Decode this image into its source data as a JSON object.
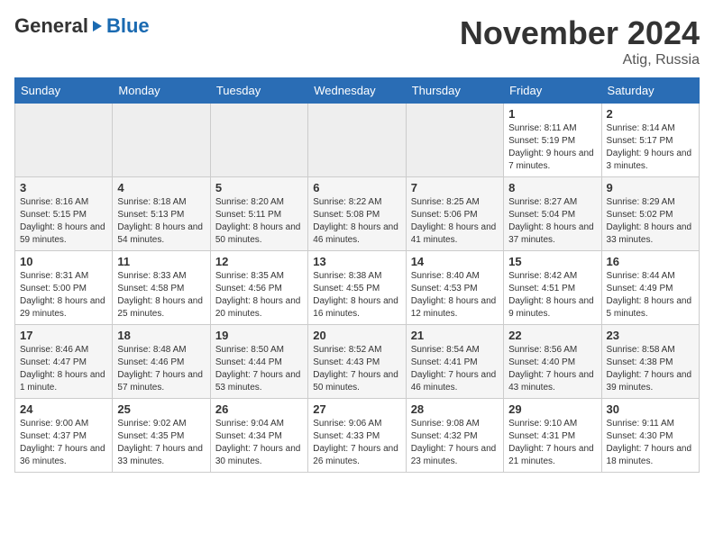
{
  "header": {
    "logo_general": "General",
    "logo_blue": "Blue",
    "month_title": "November 2024",
    "location": "Atig, Russia"
  },
  "days_of_week": [
    "Sunday",
    "Monday",
    "Tuesday",
    "Wednesday",
    "Thursday",
    "Friday",
    "Saturday"
  ],
  "weeks": [
    [
      {
        "day": "",
        "empty": true
      },
      {
        "day": "",
        "empty": true
      },
      {
        "day": "",
        "empty": true
      },
      {
        "day": "",
        "empty": true
      },
      {
        "day": "",
        "empty": true
      },
      {
        "day": "1",
        "sunrise": "Sunrise: 8:11 AM",
        "sunset": "Sunset: 5:19 PM",
        "daylight": "Daylight: 9 hours and 7 minutes."
      },
      {
        "day": "2",
        "sunrise": "Sunrise: 8:14 AM",
        "sunset": "Sunset: 5:17 PM",
        "daylight": "Daylight: 9 hours and 3 minutes."
      }
    ],
    [
      {
        "day": "3",
        "sunrise": "Sunrise: 8:16 AM",
        "sunset": "Sunset: 5:15 PM",
        "daylight": "Daylight: 8 hours and 59 minutes."
      },
      {
        "day": "4",
        "sunrise": "Sunrise: 8:18 AM",
        "sunset": "Sunset: 5:13 PM",
        "daylight": "Daylight: 8 hours and 54 minutes."
      },
      {
        "day": "5",
        "sunrise": "Sunrise: 8:20 AM",
        "sunset": "Sunset: 5:11 PM",
        "daylight": "Daylight: 8 hours and 50 minutes."
      },
      {
        "day": "6",
        "sunrise": "Sunrise: 8:22 AM",
        "sunset": "Sunset: 5:08 PM",
        "daylight": "Daylight: 8 hours and 46 minutes."
      },
      {
        "day": "7",
        "sunrise": "Sunrise: 8:25 AM",
        "sunset": "Sunset: 5:06 PM",
        "daylight": "Daylight: 8 hours and 41 minutes."
      },
      {
        "day": "8",
        "sunrise": "Sunrise: 8:27 AM",
        "sunset": "Sunset: 5:04 PM",
        "daylight": "Daylight: 8 hours and 37 minutes."
      },
      {
        "day": "9",
        "sunrise": "Sunrise: 8:29 AM",
        "sunset": "Sunset: 5:02 PM",
        "daylight": "Daylight: 8 hours and 33 minutes."
      }
    ],
    [
      {
        "day": "10",
        "sunrise": "Sunrise: 8:31 AM",
        "sunset": "Sunset: 5:00 PM",
        "daylight": "Daylight: 8 hours and 29 minutes."
      },
      {
        "day": "11",
        "sunrise": "Sunrise: 8:33 AM",
        "sunset": "Sunset: 4:58 PM",
        "daylight": "Daylight: 8 hours and 25 minutes."
      },
      {
        "day": "12",
        "sunrise": "Sunrise: 8:35 AM",
        "sunset": "Sunset: 4:56 PM",
        "daylight": "Daylight: 8 hours and 20 minutes."
      },
      {
        "day": "13",
        "sunrise": "Sunrise: 8:38 AM",
        "sunset": "Sunset: 4:55 PM",
        "daylight": "Daylight: 8 hours and 16 minutes."
      },
      {
        "day": "14",
        "sunrise": "Sunrise: 8:40 AM",
        "sunset": "Sunset: 4:53 PM",
        "daylight": "Daylight: 8 hours and 12 minutes."
      },
      {
        "day": "15",
        "sunrise": "Sunrise: 8:42 AM",
        "sunset": "Sunset: 4:51 PM",
        "daylight": "Daylight: 8 hours and 9 minutes."
      },
      {
        "day": "16",
        "sunrise": "Sunrise: 8:44 AM",
        "sunset": "Sunset: 4:49 PM",
        "daylight": "Daylight: 8 hours and 5 minutes."
      }
    ],
    [
      {
        "day": "17",
        "sunrise": "Sunrise: 8:46 AM",
        "sunset": "Sunset: 4:47 PM",
        "daylight": "Daylight: 8 hours and 1 minute."
      },
      {
        "day": "18",
        "sunrise": "Sunrise: 8:48 AM",
        "sunset": "Sunset: 4:46 PM",
        "daylight": "Daylight: 7 hours and 57 minutes."
      },
      {
        "day": "19",
        "sunrise": "Sunrise: 8:50 AM",
        "sunset": "Sunset: 4:44 PM",
        "daylight": "Daylight: 7 hours and 53 minutes."
      },
      {
        "day": "20",
        "sunrise": "Sunrise: 8:52 AM",
        "sunset": "Sunset: 4:43 PM",
        "daylight": "Daylight: 7 hours and 50 minutes."
      },
      {
        "day": "21",
        "sunrise": "Sunrise: 8:54 AM",
        "sunset": "Sunset: 4:41 PM",
        "daylight": "Daylight: 7 hours and 46 minutes."
      },
      {
        "day": "22",
        "sunrise": "Sunrise: 8:56 AM",
        "sunset": "Sunset: 4:40 PM",
        "daylight": "Daylight: 7 hours and 43 minutes."
      },
      {
        "day": "23",
        "sunrise": "Sunrise: 8:58 AM",
        "sunset": "Sunset: 4:38 PM",
        "daylight": "Daylight: 7 hours and 39 minutes."
      }
    ],
    [
      {
        "day": "24",
        "sunrise": "Sunrise: 9:00 AM",
        "sunset": "Sunset: 4:37 PM",
        "daylight": "Daylight: 7 hours and 36 minutes."
      },
      {
        "day": "25",
        "sunrise": "Sunrise: 9:02 AM",
        "sunset": "Sunset: 4:35 PM",
        "daylight": "Daylight: 7 hours and 33 minutes."
      },
      {
        "day": "26",
        "sunrise": "Sunrise: 9:04 AM",
        "sunset": "Sunset: 4:34 PM",
        "daylight": "Daylight: 7 hours and 30 minutes."
      },
      {
        "day": "27",
        "sunrise": "Sunrise: 9:06 AM",
        "sunset": "Sunset: 4:33 PM",
        "daylight": "Daylight: 7 hours and 26 minutes."
      },
      {
        "day": "28",
        "sunrise": "Sunrise: 9:08 AM",
        "sunset": "Sunset: 4:32 PM",
        "daylight": "Daylight: 7 hours and 23 minutes."
      },
      {
        "day": "29",
        "sunrise": "Sunrise: 9:10 AM",
        "sunset": "Sunset: 4:31 PM",
        "daylight": "Daylight: 7 hours and 21 minutes."
      },
      {
        "day": "30",
        "sunrise": "Sunrise: 9:11 AM",
        "sunset": "Sunset: 4:30 PM",
        "daylight": "Daylight: 7 hours and 18 minutes."
      }
    ]
  ]
}
